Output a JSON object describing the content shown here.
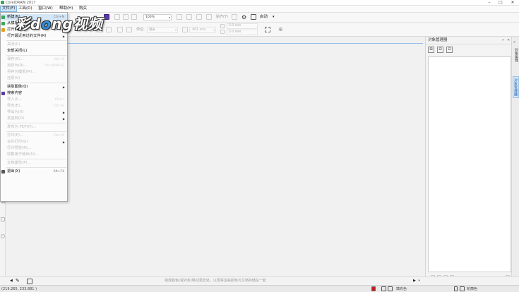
{
  "app": {
    "title": "CorelDRAW 2017"
  },
  "window": {
    "minimize": "–",
    "maximize": "□",
    "close": "✕"
  },
  "menubar": [
    {
      "label": "文件(F)",
      "active": true
    },
    {
      "label": "工具(O)"
    },
    {
      "label": "窗口(W)"
    },
    {
      "label": "帮助(H)"
    },
    {
      "label": "购买"
    }
  ],
  "toolbar": {
    "zoom": "100%",
    "snap": "贴齐(T)",
    "launch": "启动"
  },
  "propbar": {
    "units_label": "单位:",
    "units": "毫米",
    "nudge": ".001 mm",
    "dup_x": "5.0 mm",
    "dup_y": "5.0 mm"
  },
  "watermark": {
    "text_a": "彩",
    "text_b": "d",
    "text_c": "ng",
    "text_d": "视频",
    "dot": "o"
  },
  "file_menu": {
    "items": [
      {
        "label": "新建(N)...",
        "shortcut": "Ctrl+N",
        "enabled": true,
        "icon": "new-document-icon",
        "highlight": true
      },
      {
        "label": "从模板新建(F)...",
        "shortcut": "",
        "enabled": true,
        "icon": "template-icon"
      },
      {
        "label": "打开(O)...",
        "shortcut": "Ctrl+O",
        "enabled": true,
        "icon": "open-folder-icon"
      },
      {
        "label": "打开最近用过的文件(R)",
        "shortcut": "",
        "enabled": true,
        "submenu": true
      },
      {
        "sep": true
      },
      {
        "label": "关闭(C)",
        "shortcut": "",
        "enabled": false
      },
      {
        "label": "全部关闭(L)",
        "shortcut": "",
        "enabled": true
      },
      {
        "sep": true
      },
      {
        "label": "保存(S)...",
        "shortcut": "Ctrl+S",
        "enabled": false
      },
      {
        "label": "另存为(A)...",
        "shortcut": "Ctrl+Shift+S",
        "enabled": false
      },
      {
        "label": "另存为模板(M)...",
        "shortcut": "",
        "enabled": false
      },
      {
        "label": "还原(V)",
        "shortcut": "",
        "enabled": false
      },
      {
        "sep": true
      },
      {
        "label": "获取图像(Q)",
        "shortcut": "",
        "enabled": true,
        "submenu": true
      },
      {
        "label": "搜索内容",
        "shortcut": "",
        "enabled": true,
        "icon": "search-content-icon"
      },
      {
        "label": "导入(I)...",
        "shortcut": "Ctrl+I",
        "enabled": false
      },
      {
        "label": "导出(E)...",
        "shortcut": "Ctrl+E",
        "enabled": false
      },
      {
        "label": "导出为(X)",
        "shortcut": "",
        "enabled": false,
        "submenu": true
      },
      {
        "label": "发送到(D)",
        "shortcut": "",
        "enabled": false,
        "submenu": true
      },
      {
        "sep": true
      },
      {
        "label": "发布为 PDF(H)...",
        "shortcut": "",
        "enabled": false
      },
      {
        "sep": true
      },
      {
        "label": "打印(P)...",
        "shortcut": "Ctrl+P",
        "enabled": false
      },
      {
        "label": "合并打印(G)",
        "shortcut": "",
        "enabled": false,
        "submenu": true
      },
      {
        "label": "打印预览(R)...",
        "shortcut": "",
        "enabled": false
      },
      {
        "label": "收集用于输出(U)...",
        "shortcut": "",
        "enabled": false
      },
      {
        "sep": true
      },
      {
        "label": "文档属性(P)...",
        "shortcut": "",
        "enabled": false
      },
      {
        "sep": true
      },
      {
        "label": "退出(X)",
        "shortcut": "Alt+F4",
        "enabled": true,
        "icon": "exit-icon"
      }
    ]
  },
  "object_manager": {
    "title": "对象管理器",
    "tools": [
      "⊞",
      "⊟",
      "⊡"
    ],
    "side_tabs": [
      "对象属性",
      "对象管理器"
    ]
  },
  "hint": "拖放颜色(或对象)移动至此处，以便将这些颜色与文档存储在一起",
  "status": {
    "coords": "(219.265, 233.881 )",
    "fill_label": "填充色",
    "outline_label": "轮廓色"
  },
  "colors": {
    "accent": "#2d8fe0",
    "menu_highlight": "#d3e7f8",
    "menu_border": "#7fb2e0"
  }
}
